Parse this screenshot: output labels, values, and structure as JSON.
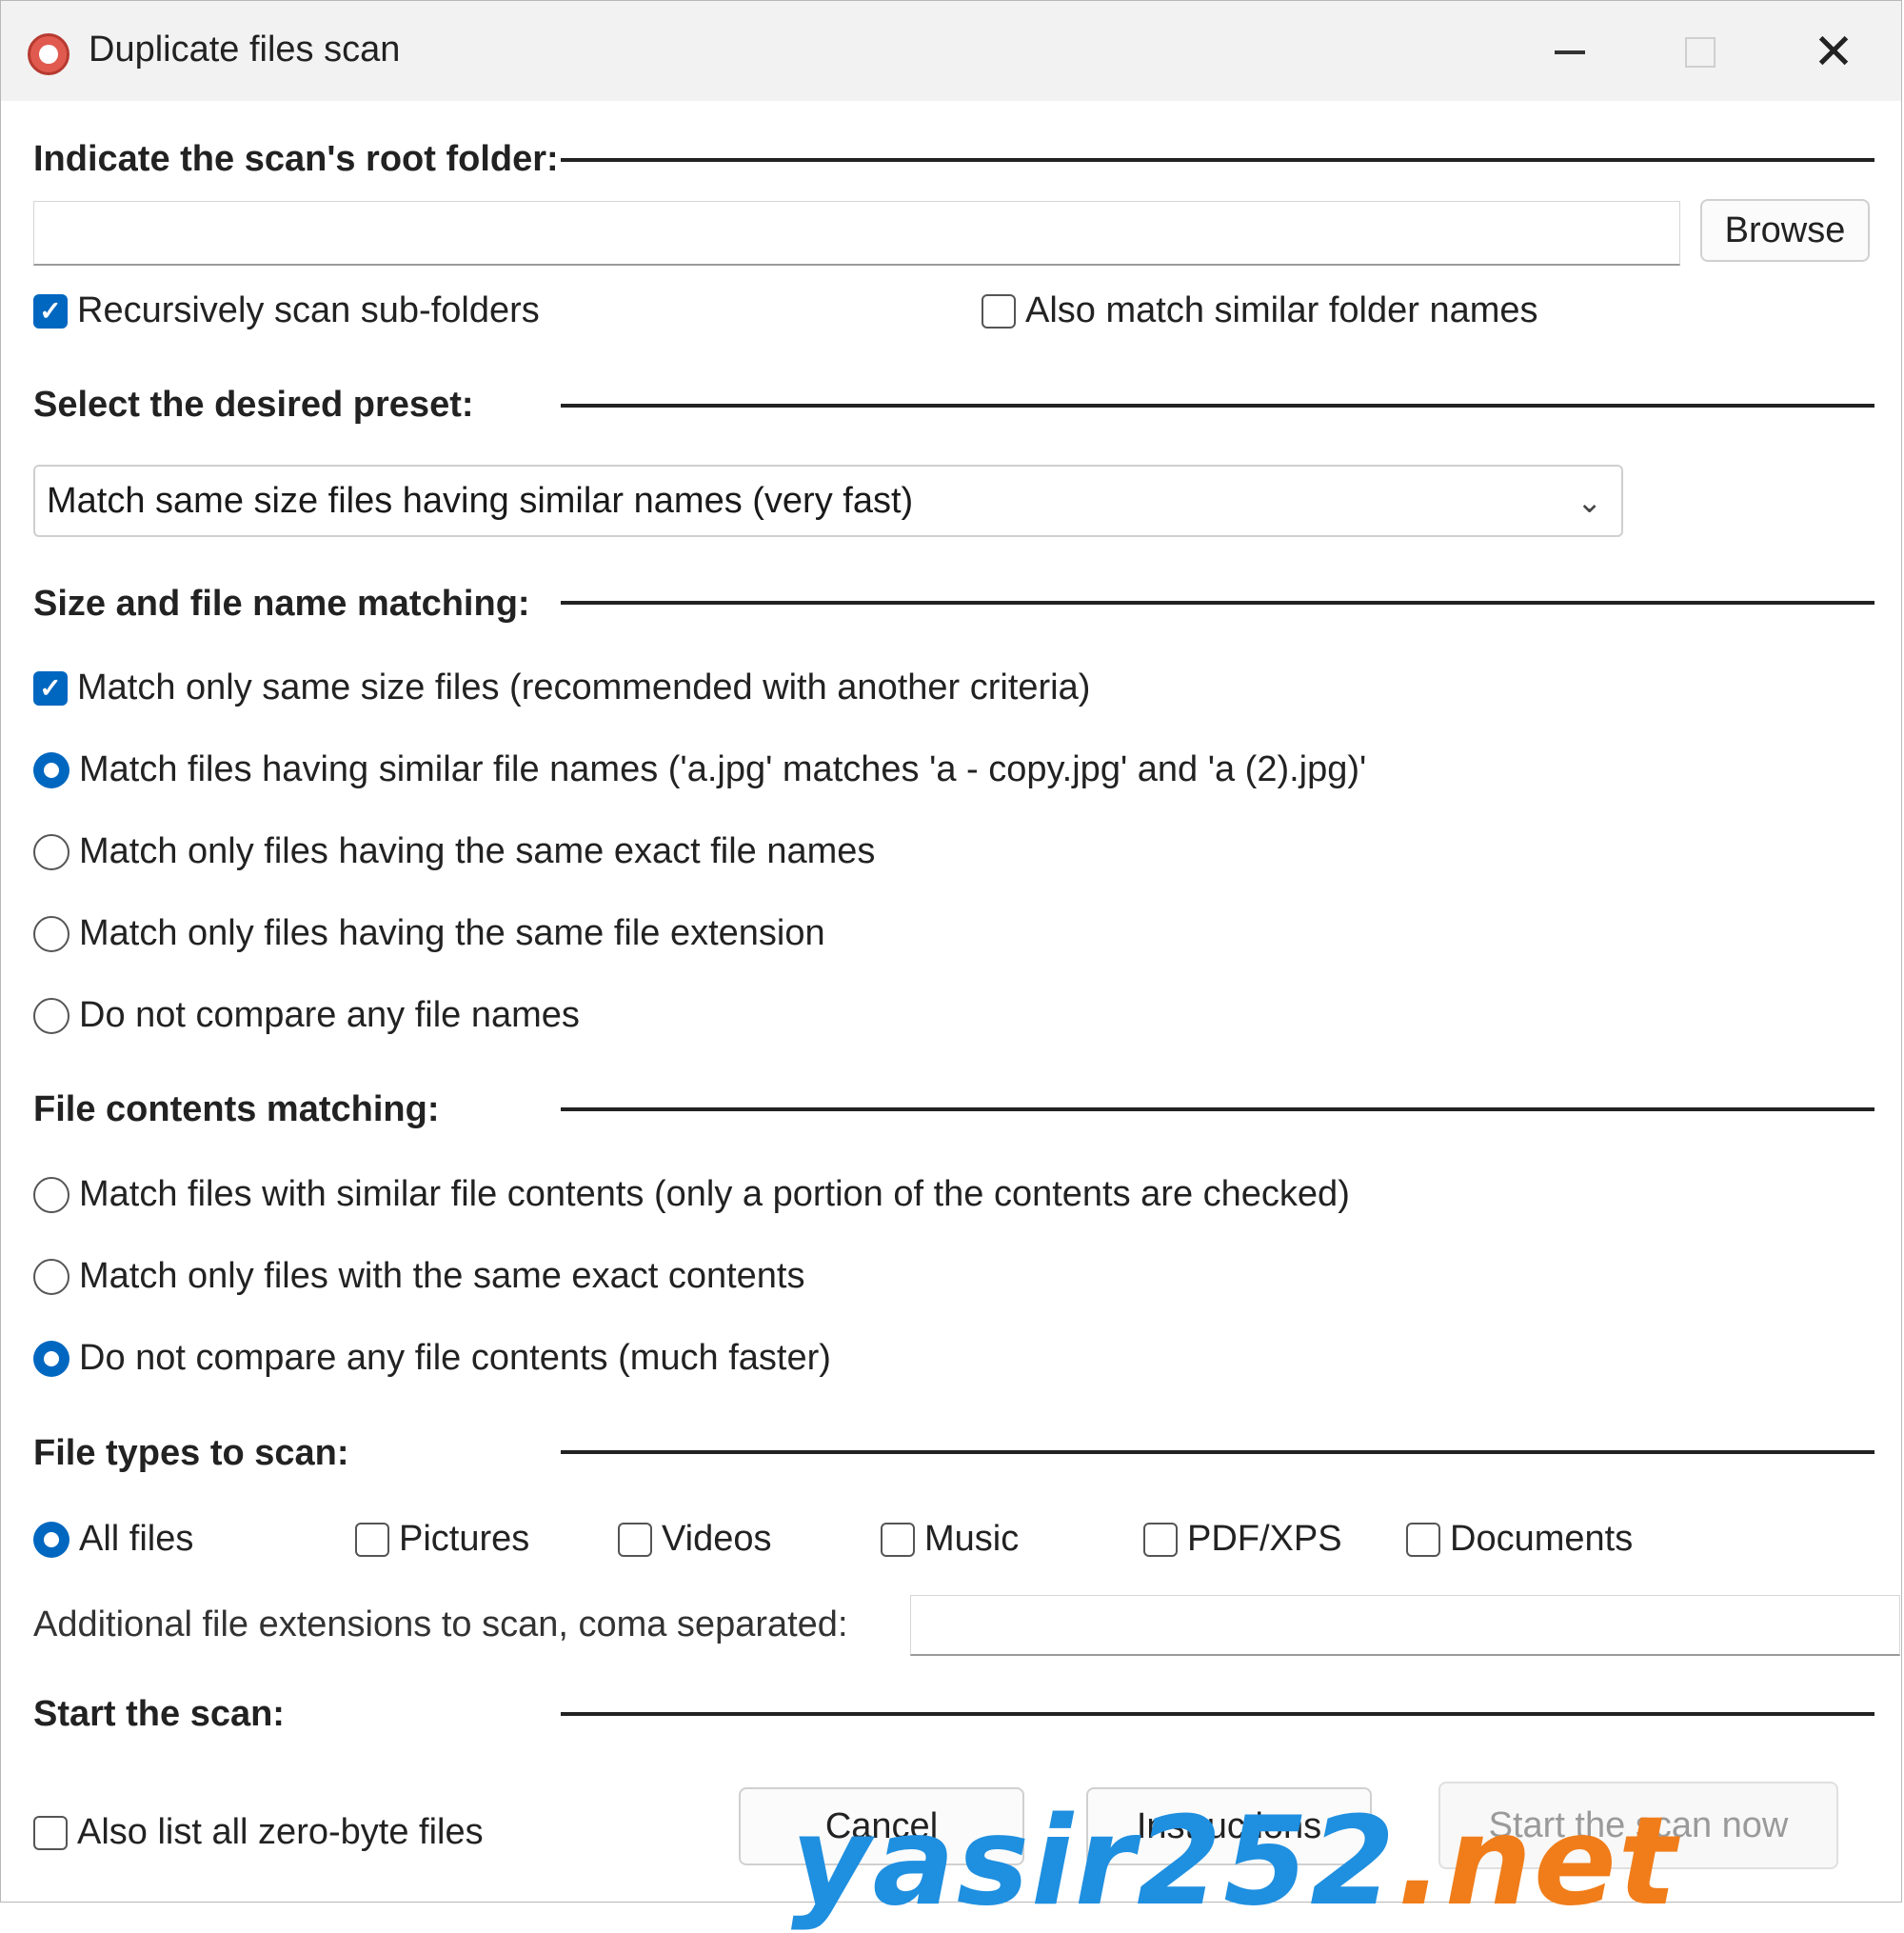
{
  "window": {
    "title": "Duplicate files scan",
    "controls": {
      "minimize": "minimize",
      "maximize": "maximize",
      "close": "✕"
    }
  },
  "root_folder": {
    "header": "Indicate the scan's root folder:",
    "path_value": "",
    "browse_label": "Browse",
    "recursive_label": "Recursively scan sub-folders",
    "recursive_checked": true,
    "similar_folders_label": "Also match similar folder names",
    "similar_folders_checked": false
  },
  "preset": {
    "header": "Select the desired preset:",
    "selected": "Match same size files having similar names (very fast)"
  },
  "name_matching": {
    "header": "Size and file name matching:",
    "same_size_label": "Match only same size files (recommended with another criteria)",
    "same_size_checked": true,
    "options": [
      {
        "label": "Match files having similar file names ('a.jpg' matches 'a - copy.jpg' and 'a (2).jpg)'",
        "selected": true
      },
      {
        "label": "Match only files having the same exact file names",
        "selected": false
      },
      {
        "label": "Match only files having the same file extension",
        "selected": false
      },
      {
        "label": "Do not compare any file names",
        "selected": false
      }
    ]
  },
  "contents_matching": {
    "header": "File contents matching:",
    "options": [
      {
        "label": "Match files with similar file contents (only a portion of the contents are checked)",
        "selected": false
      },
      {
        "label": "Match only files with the same exact contents",
        "selected": false
      },
      {
        "label": "Do not compare any file contents (much faster)",
        "selected": true
      }
    ]
  },
  "file_types": {
    "header": "File types to scan:",
    "all_files_label": "All files",
    "types": [
      {
        "label": "Pictures",
        "checked": false
      },
      {
        "label": "Videos",
        "checked": false
      },
      {
        "label": "Music",
        "checked": false
      },
      {
        "label": "PDF/XPS",
        "checked": false
      },
      {
        "label": "Documents",
        "checked": false
      }
    ],
    "extensions_label": "Additional file extensions to scan, coma separated:",
    "extensions_value": ""
  },
  "start": {
    "header": "Start the scan:",
    "zero_byte_label": "Also list all zero-byte files",
    "zero_byte_checked": false,
    "cancel_label": "Cancel",
    "instructions_label": "Instructions",
    "start_label": "Start the scan now"
  },
  "watermark": {
    "part1": "yasir252",
    "part2": ".net"
  },
  "colors": {
    "accent": "#0067c0",
    "watermark_blue": "#1f8fe0",
    "watermark_orange": "#f07d1a"
  }
}
